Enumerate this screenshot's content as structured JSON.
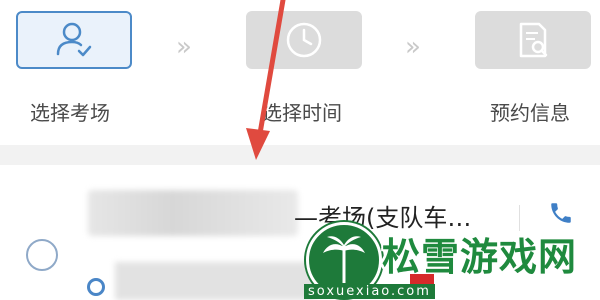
{
  "steps": [
    {
      "label": "选择考场",
      "icon": "user-check-icon",
      "state": "active"
    },
    {
      "label": "选择时间",
      "icon": "clock-icon",
      "state": "inactive"
    },
    {
      "label": "预约信息",
      "icon": "document-search-icon",
      "state": "inactive"
    }
  ],
  "separator_glyph": "»",
  "exam_hall": {
    "name_suffix": "—考场(支队车…",
    "phone_icon": "phone-icon"
  },
  "watermark": {
    "title": "松雪游戏网",
    "url": "soxuexiao.com"
  },
  "colors": {
    "accent": "#4c8ac8",
    "arrow": "#e04a3f",
    "watermark_green": "#1f8a3e"
  }
}
